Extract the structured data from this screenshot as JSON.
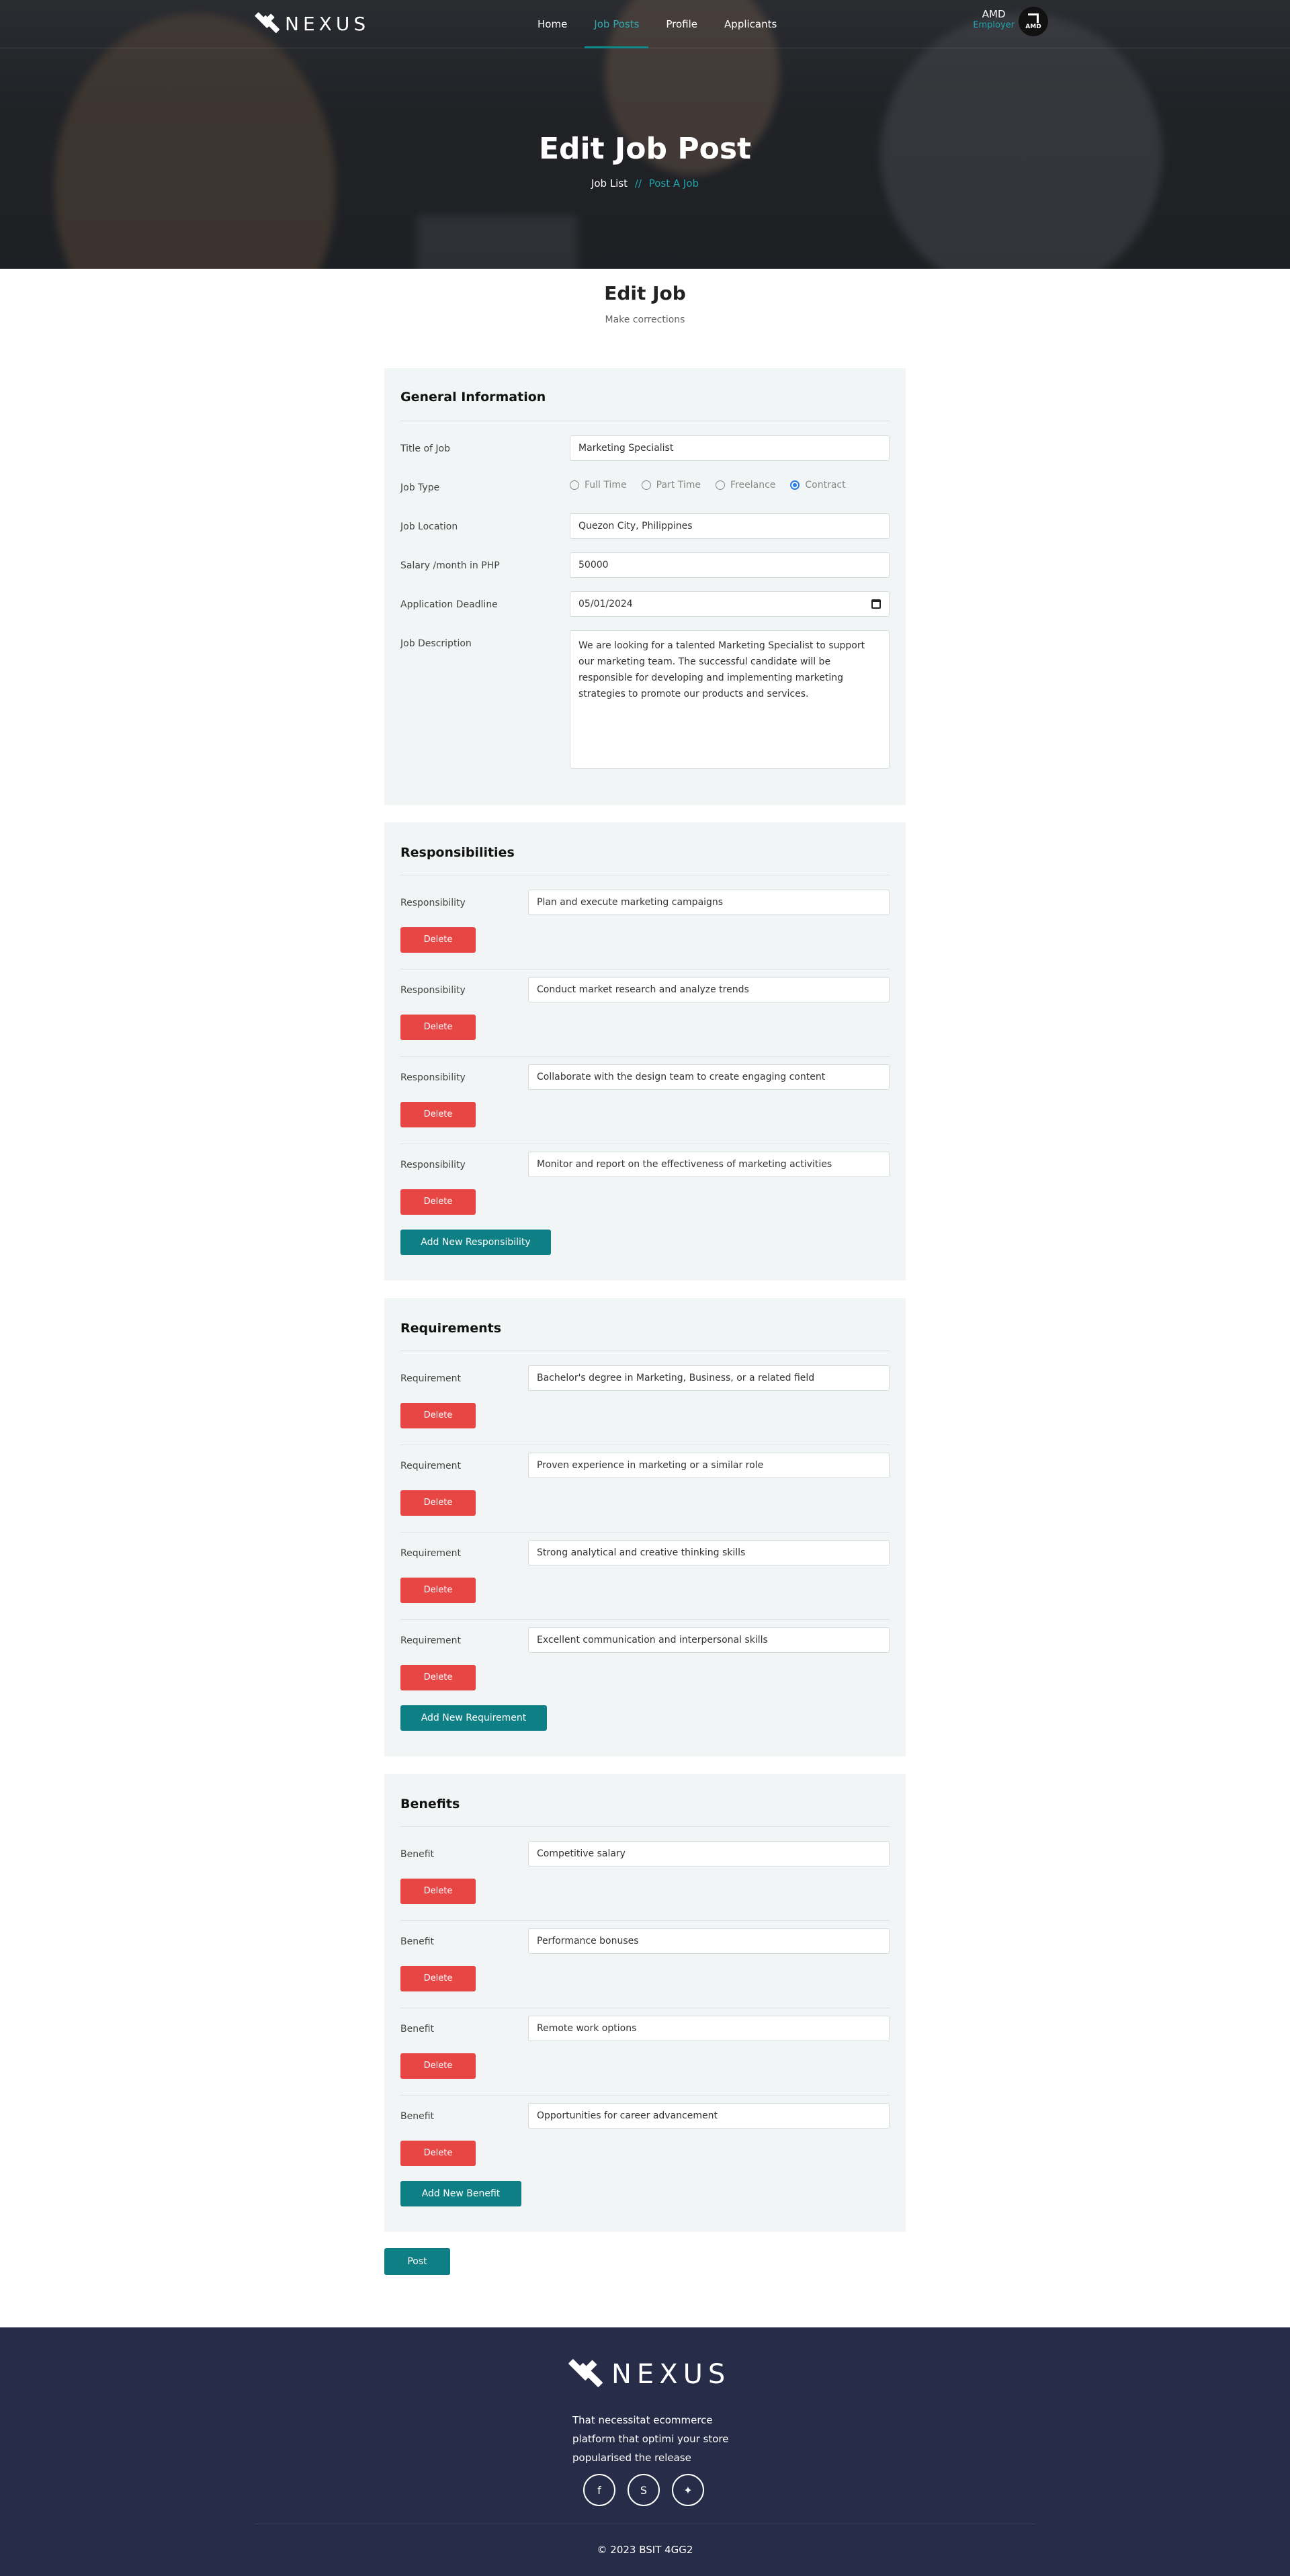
{
  "header": {
    "brand": "NEXUS",
    "nav": [
      {
        "label": "Home",
        "active": false
      },
      {
        "label": "Job Posts",
        "active": true
      },
      {
        "label": "Profile",
        "active": false
      },
      {
        "label": "Applicants",
        "active": false
      }
    ],
    "user": {
      "name": "AMD",
      "role": "Employer",
      "avatar_text": "AMD"
    }
  },
  "hero": {
    "title": "Edit Job Post",
    "breadcrumb": {
      "parent": "Job List",
      "separator": "//",
      "current": "Post A Job"
    }
  },
  "section": {
    "title": "Edit Job",
    "subtitle": "Make corrections"
  },
  "general": {
    "heading": "General Information",
    "title_label": "Title of Job",
    "title_value": "Marketing Specialist",
    "type_label": "Job Type",
    "type_options": [
      {
        "label": "Full Time",
        "checked": false
      },
      {
        "label": "Part Time",
        "checked": false
      },
      {
        "label": "Freelance",
        "checked": false
      },
      {
        "label": "Contract",
        "checked": true
      }
    ],
    "location_label": "Job Location",
    "location_value": "Quezon City, Philippines",
    "salary_label": "Salary /month in PHP",
    "salary_value": "50000",
    "deadline_label": "Application Deadline",
    "deadline_value": "05/01/2024",
    "description_label": "Job Description",
    "description_value": "We are looking for a talented Marketing Specialist to support our marketing team. The successful candidate will be responsible for developing and implementing marketing strategies to promote our products and services."
  },
  "responsibilities": {
    "heading": "Responsibilities",
    "item_label": "Responsibility",
    "delete_label": "Delete",
    "items": [
      "Plan and execute marketing campaigns",
      "Conduct market research and analyze trends",
      "Collaborate with the design team to create engaging content",
      "Monitor and report on the effectiveness of marketing activities"
    ],
    "add_label": "Add New Responsibility"
  },
  "requirements": {
    "heading": "Requirements",
    "item_label": "Requirement",
    "delete_label": "Delete",
    "items": [
      "Bachelor's degree in Marketing, Business, or a related field",
      "Proven experience in marketing or a similar role",
      "Strong analytical and creative thinking skills",
      "Excellent communication and interpersonal skills"
    ],
    "add_label": "Add New Requirement"
  },
  "benefits": {
    "heading": "Benefits",
    "item_label": "Benefit",
    "delete_label": "Delete",
    "items": [
      "Competitive salary",
      "Performance bonuses",
      "Remote work options",
      "Opportunities for career advancement"
    ],
    "add_label": "Add New Benefit"
  },
  "post_label": "Post",
  "footer": {
    "brand": "NEXUS",
    "text": "That necessitat ecommerce platform that optimi your store popularised the release",
    "socials": [
      "facebook-icon",
      "skype-icon",
      "twitter-icon"
    ],
    "copyright": "© 2023 BSIT 4GG2"
  },
  "colors": {
    "accent": "#0e7f84",
    "danger": "#e84545",
    "footer_bg": "#272c48",
    "card_bg": "#f2f5f5"
  }
}
